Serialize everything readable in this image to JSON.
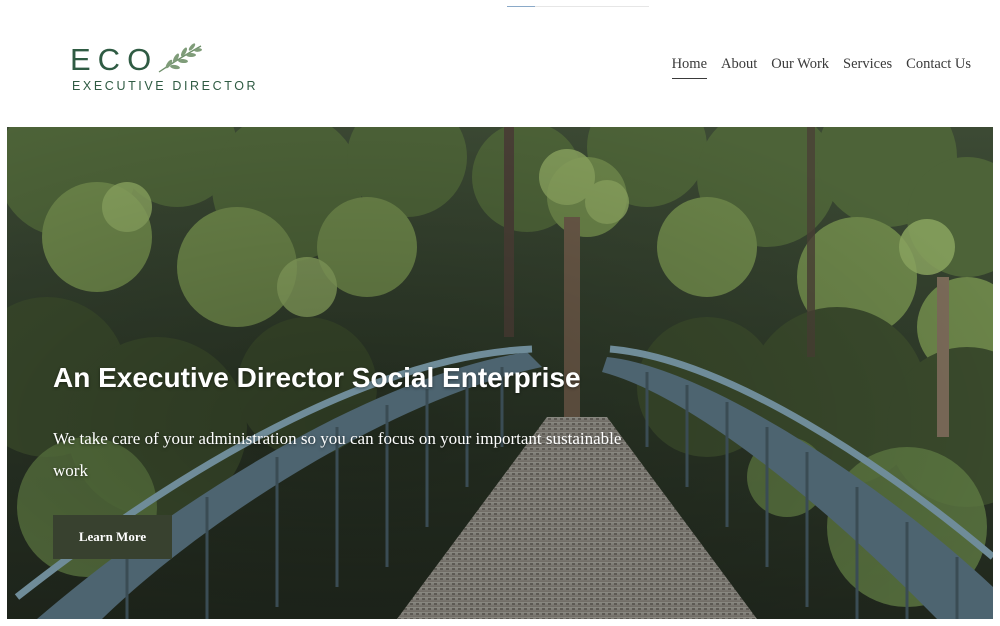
{
  "progress": {
    "fraction": 0.2
  },
  "logo": {
    "title": "ECO",
    "subtitle": "EXECUTIVE DIRECTOR",
    "icon": "leaf-icon"
  },
  "nav": {
    "items": [
      "Home",
      "About",
      "Our Work",
      "Services",
      "Contact Us"
    ],
    "active": "Home"
  },
  "hero": {
    "title": "An Executive Director Social Enterprise",
    "text": "We take care of your administration so you can focus on your important sustainable work",
    "button": "Learn More"
  },
  "colors": {
    "brand": "#2f5b43",
    "button": "#38412f",
    "text": "#3a3a3a"
  }
}
